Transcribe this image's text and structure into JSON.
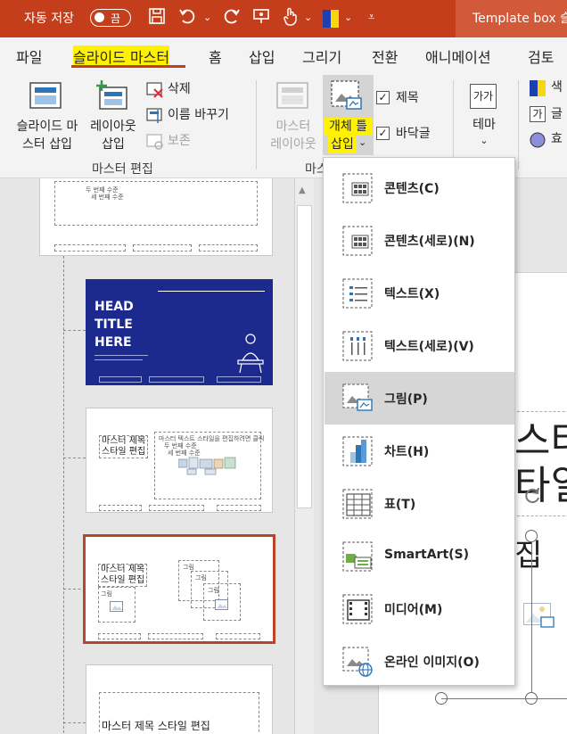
{
  "titlebar": {
    "autosave_label": "자동 저장",
    "autosave_state": "끔",
    "doc_title": "Template box 슬",
    "icons": [
      "save-icon",
      "undo-icon",
      "redo-icon",
      "presenter-icon",
      "touch-icon",
      "theme-color-icon",
      "customize-icon"
    ],
    "colors": {
      "bar": "#c43e1c"
    }
  },
  "tabs": [
    "파일",
    "슬라이드 마스터",
    "홈",
    "삽입",
    "그리기",
    "전환",
    "애니메이션",
    "검토"
  ],
  "ribbon": {
    "master_edit": {
      "insert_master": [
        "슬라이드 마",
        "스터 삽입"
      ],
      "insert_layout": [
        "레이아웃",
        "삽입"
      ],
      "delete": "삭제",
      "rename": "이름 바꾸기",
      "preserve": "보존",
      "group_label": "마스터 편집"
    },
    "master_layout": {
      "master_layout_btn": [
        "마스터",
        "레이아웃"
      ],
      "insert_placeholder": [
        "개체 틀",
        "삽입"
      ],
      "title_check": "제목",
      "footer_check": "바닥글",
      "group_label": "마스"
    },
    "theme": {
      "label": "테마",
      "icon_text": "가가"
    },
    "right_partial": [
      "색",
      "글",
      "효"
    ]
  },
  "dropdown": {
    "items": [
      {
        "label": "콘텐츠(C)",
        "icon": "content-placeholder-icon"
      },
      {
        "label": "콘텐츠(세로)(N)",
        "icon": "content-vertical-placeholder-icon"
      },
      {
        "label": "텍스트(X)",
        "icon": "text-placeholder-icon"
      },
      {
        "label": "텍스트(세로)(V)",
        "icon": "text-vertical-placeholder-icon"
      },
      {
        "label": "그림(P)",
        "icon": "picture-placeholder-icon",
        "selected": true
      },
      {
        "label": "차트(H)",
        "icon": "chart-placeholder-icon"
      },
      {
        "label": "표(T)",
        "icon": "table-placeholder-icon"
      },
      {
        "label": "SmartArt(S)",
        "icon": "smartart-placeholder-icon"
      },
      {
        "label": "미디어(M)",
        "icon": "media-placeholder-icon"
      },
      {
        "label": "온라인 이미지(O)",
        "icon": "online-image-placeholder-icon"
      }
    ]
  },
  "thumbnails": {
    "blue_slide": {
      "line1": "HEAD",
      "line2": "TITLE",
      "line3": "HERE"
    },
    "master_title": [
      "마스터 제목",
      "스타일 편집"
    ],
    "master_text": "마스터 텍스트 스타일을 편집하려면 클릭",
    "level2": "두 번째 수준",
    "level3": "세 번째 수준",
    "picture_label": "그림",
    "last_title": "마스터 제목 스타일 편집",
    "colors": {
      "blue_slide": "#1b2a8c",
      "selected_border": "#b7472a"
    }
  },
  "canvas": {
    "big1": "스터",
    "big2": "타일",
    "big3": "집"
  }
}
